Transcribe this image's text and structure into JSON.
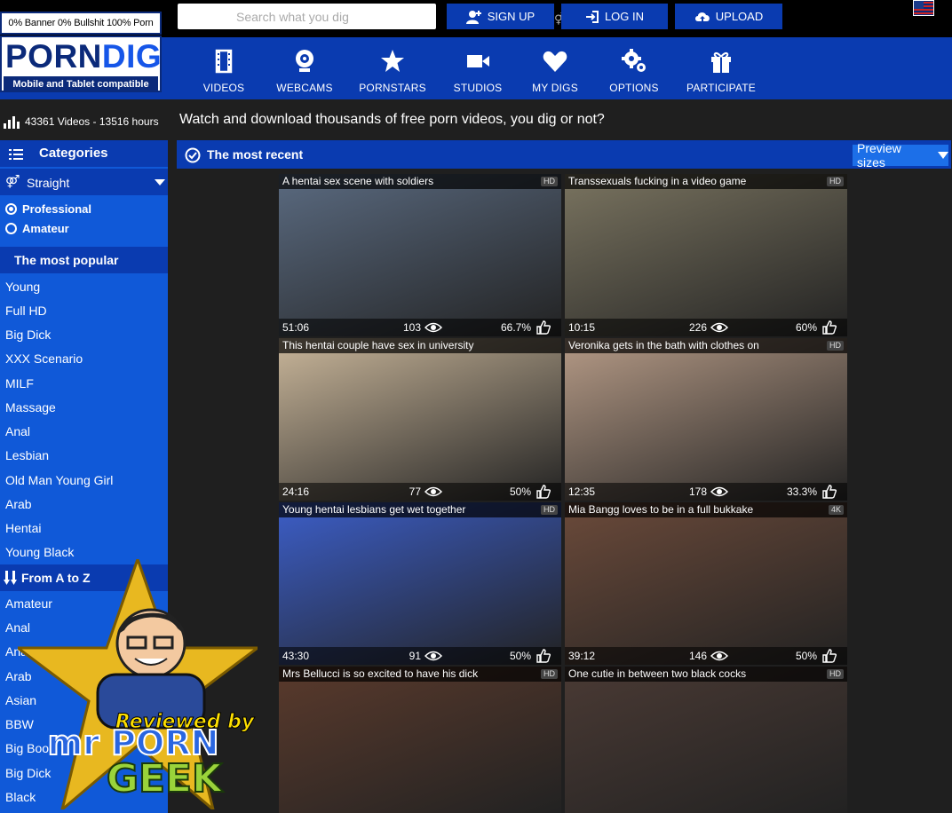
{
  "topbar": {
    "tagline": "0% Banner 0% Bullshit 100% Porn",
    "search_placeholder": "Search what you dig",
    "signup": "SIGN UP",
    "login": "LOG IN",
    "upload": "UPLOAD"
  },
  "logo": {
    "porn": "PORN",
    "dig": "DIG",
    "subtitle": "Mobile and Tablet compatible"
  },
  "nav": [
    {
      "label": "VIDEOS",
      "icon": "film-icon"
    },
    {
      "label": "WEBCAMS",
      "icon": "webcam-icon"
    },
    {
      "label": "PORNSTARS",
      "icon": "star-icon"
    },
    {
      "label": "STUDIOS",
      "icon": "video-camera-icon"
    },
    {
      "label": "MY DIGS",
      "icon": "heart-icon"
    },
    {
      "label": "OPTIONS",
      "icon": "gears-icon"
    },
    {
      "label": "PARTICIPATE",
      "icon": "gift-icon"
    }
  ],
  "stats": {
    "text": "43361 Videos - 13516 hours",
    "tagline": "Watch and download thousands of free porn videos, you dig or not?"
  },
  "sidebar": {
    "categories_label": "Categories",
    "orientation": "Straight",
    "radio": [
      {
        "label": "Professional",
        "checked": true
      },
      {
        "label": "Amateur",
        "checked": false
      }
    ],
    "popular_label": "The most popular",
    "popular": [
      "Young",
      "Full HD",
      "Big Dick",
      "XXX Scenario",
      "MILF",
      "Massage",
      "Anal",
      "Lesbian",
      "Old Man Young Girl",
      "Arab",
      "Hentai",
      "Young Black"
    ],
    "atoz_label": "From A to Z",
    "atoz": [
      "Amateur",
      "Anal",
      "Ana",
      "Arab",
      "Asian",
      "BBW",
      "Big Boo",
      "Big Dick",
      "Black"
    ]
  },
  "main": {
    "section_title": "The most recent",
    "preview_sizes": "Preview sizes"
  },
  "videos": [
    {
      "title": "A hentai sex scene with soldiers",
      "badge": "HD",
      "duration": "51:06",
      "views": "103",
      "rating": "66.7%",
      "color": "#5a6a80"
    },
    {
      "title": "Transsexuals fucking in a video game",
      "badge": "HD",
      "duration": "10:15",
      "views": "226",
      "rating": "60%",
      "color": "#7a7460"
    },
    {
      "title": "This hentai couple have sex in university",
      "badge": "",
      "duration": "24:16",
      "views": "77",
      "rating": "50%",
      "color": "#c9b69a"
    },
    {
      "title": "Veronika gets in the bath with clothes on",
      "badge": "HD",
      "duration": "12:35",
      "views": "178",
      "rating": "33.3%",
      "color": "#b59a86"
    },
    {
      "title": "Young hentai lesbians get wet together",
      "badge": "HD",
      "duration": "43:30",
      "views": "91",
      "rating": "50%",
      "color": "#3c5ec8"
    },
    {
      "title": "Mia Bangg loves to be in a full bukkake",
      "badge": "4K",
      "duration": "39:12",
      "views": "146",
      "rating": "50%",
      "color": "#6b4a3a"
    },
    {
      "title": "Mrs Bellucci is so excited to have his dick",
      "badge": "HD",
      "duration": "",
      "views": "",
      "rating": "",
      "color": "#5a3a2c"
    },
    {
      "title": "One cutie in between two black cocks",
      "badge": "HD",
      "duration": "",
      "views": "",
      "rating": "",
      "color": "#4a3a34"
    }
  ],
  "watermark": {
    "line1": "Reviewed by",
    "line2": "mr PORN",
    "line3": "GEEK"
  }
}
